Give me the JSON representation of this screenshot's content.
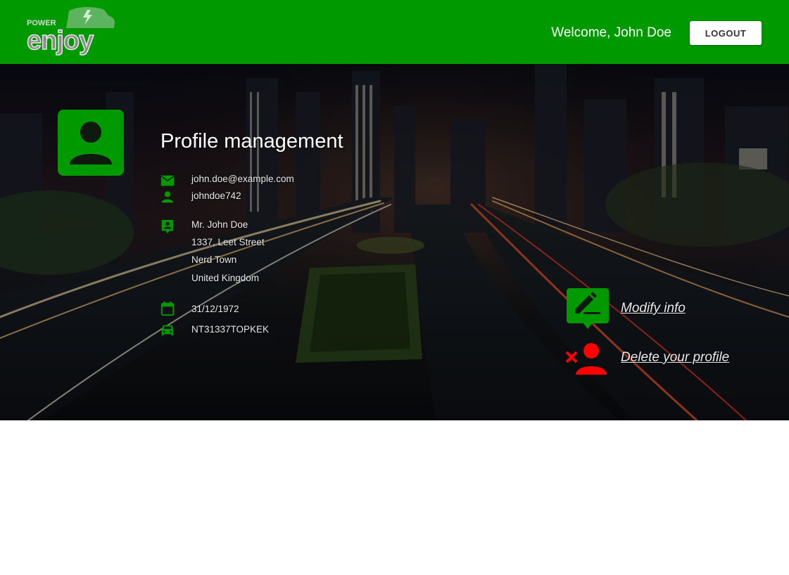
{
  "header": {
    "logo_alt": "Power Enjoy",
    "logo_top_word": "POWER",
    "logo_main_word": "enjoy",
    "welcome_text": "Welcome, John Doe",
    "logout_label": "LOGOUT"
  },
  "profile": {
    "title": "Profile management",
    "email": "john.doe@example.com",
    "username": "johndoe742",
    "name": "Mr. John Doe",
    "address_line1": "1337, Leet Street",
    "address_line2": "Nerd Town",
    "address_line3": "United Kingdom",
    "birth_date": "31/12/1972",
    "license": "NT31337TOPKEK"
  },
  "actions": {
    "modify_label": "Modify info",
    "delete_label": "Delete your profile"
  },
  "colors": {
    "brand_green": "#009900",
    "danger_red": "#ff0000",
    "header_text": "#ffffff"
  },
  "icons": {
    "email": "email-icon",
    "username": "person-icon",
    "name": "contact-card-icon",
    "birth_date": "calendar-icon",
    "license": "car-icon",
    "modify": "edit-comment-icon",
    "delete": "remove-user-icon"
  }
}
